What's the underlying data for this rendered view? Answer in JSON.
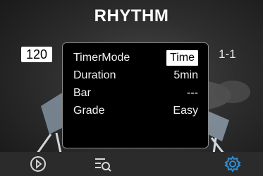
{
  "header": {
    "title": "RHYTHM"
  },
  "tempo": {
    "bpm": "120"
  },
  "position": {
    "measure": "1-1"
  },
  "settings": {
    "rows": [
      {
        "label": "TimerMode",
        "value": "Time"
      },
      {
        "label": "Duration",
        "value": "5min"
      },
      {
        "label": "Bar",
        "value": "---"
      },
      {
        "label": "Grade",
        "value": "Easy"
      }
    ]
  },
  "toolbar": {
    "play_icon": "play-circle-icon",
    "list_icon": "list-search-icon",
    "settings_icon": "gear-icon",
    "accent_color": "#2f8fd6"
  }
}
